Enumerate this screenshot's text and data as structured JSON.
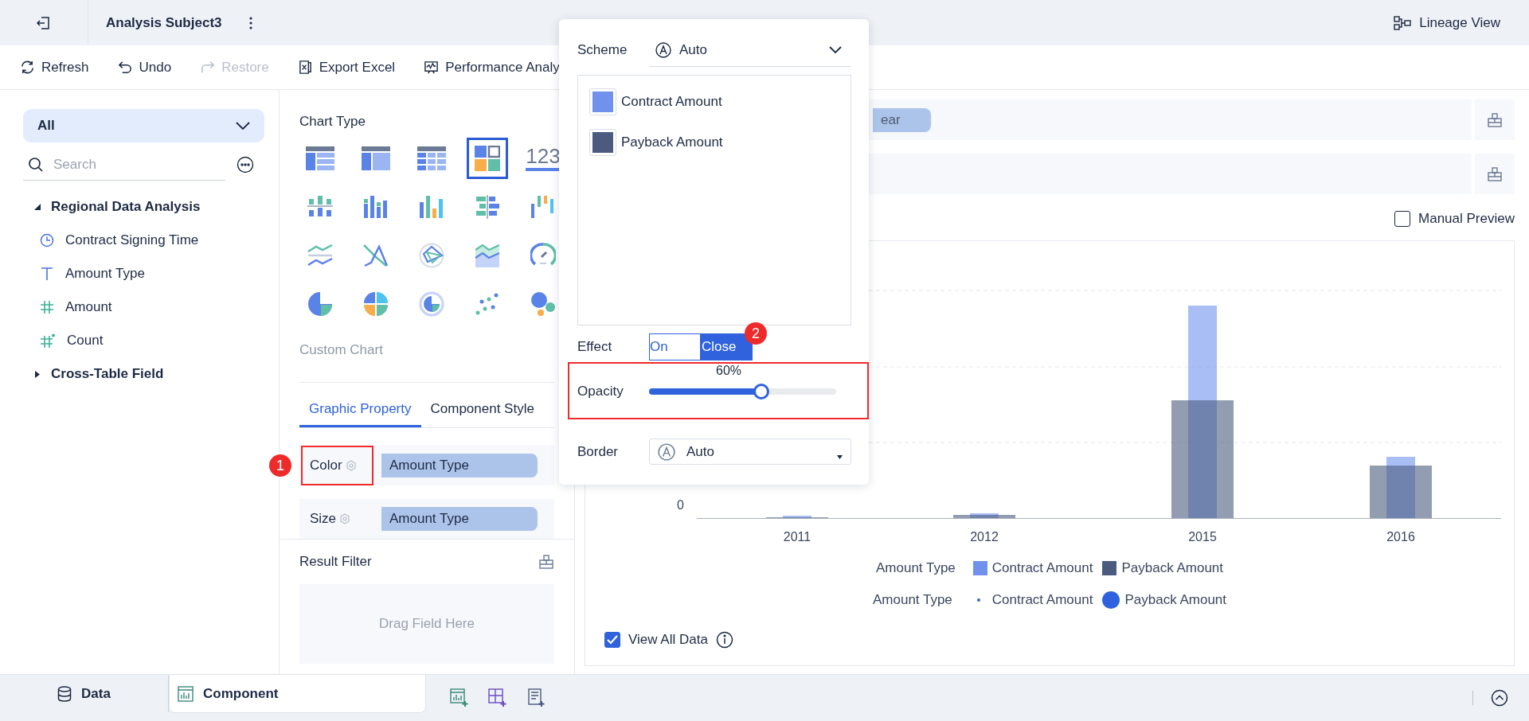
{
  "header": {
    "title": "Analysis Subject3",
    "lineage_button": "Lineage View"
  },
  "toolbar": [
    {
      "label": "Refresh",
      "disabled": false
    },
    {
      "label": "Undo",
      "disabled": false
    },
    {
      "label": "Restore",
      "disabled": true
    },
    {
      "label": "Export Excel",
      "disabled": false
    },
    {
      "label": "Performance Analy",
      "disabled": false
    }
  ],
  "fields_panel": {
    "scope": "All",
    "search_placeholder": "Search",
    "tree": [
      {
        "label": "Regional Data Analysis",
        "expanded": true,
        "children": [
          {
            "label": "Contract Signing Time",
            "kind": "date"
          },
          {
            "label": "Amount Type",
            "kind": "text"
          },
          {
            "label": "Amount",
            "kind": "number"
          },
          {
            "label": "Count",
            "kind": "count"
          }
        ]
      },
      {
        "label": "Cross-Table Field",
        "expanded": false
      }
    ]
  },
  "chart_type_panel": {
    "heading": "Chart Type",
    "types": [
      {
        "selected": false
      },
      {
        "selected": false
      },
      {
        "selected": false
      },
      {
        "selected": true
      },
      {
        "selected": false,
        "label": "123"
      },
      {
        "selected": false
      },
      {
        "selected": false
      },
      {
        "selected": false
      },
      {
        "selected": false
      },
      {
        "selected": false
      },
      {
        "selected": false
      },
      {
        "selected": false
      },
      {
        "selected": false
      },
      {
        "selected": false
      },
      {
        "selected": false
      },
      {
        "selected": false
      },
      {
        "selected": false
      },
      {
        "selected": false
      },
      {
        "selected": false
      },
      {
        "selected": false
      }
    ],
    "custom_heading": "Custom Chart"
  },
  "property_tabs": [
    {
      "label": "Graphic Property",
      "selected": true
    },
    {
      "label": "Component Style",
      "selected": false
    }
  ],
  "properties": [
    {
      "label": "Color",
      "field": "Amount Type",
      "highlighted": true,
      "callout": "1"
    },
    {
      "label": "Size",
      "field": "Amount Type",
      "highlighted": false
    }
  ],
  "result_filter": {
    "title": "Result Filter",
    "placeholder": "Drag Field Here"
  },
  "popup": {
    "scheme_label": "Scheme",
    "scheme": "Auto",
    "colors": [
      {
        "label": "Contract Amount",
        "color": "#7092ec"
      },
      {
        "label": "Payback Amount",
        "color": "#4b5b7f"
      }
    ],
    "effect_label": "Effect",
    "effect_options": [
      {
        "label": "On",
        "selected": false
      },
      {
        "label": "Close",
        "selected": true
      }
    ],
    "effect_callout": "2",
    "opacity_label": "Opacity",
    "opacity_reading": "60%",
    "opacity": {
      "level": 0.6
    },
    "opacity_highlighted": true,
    "border_label": "Border",
    "border": "Auto"
  },
  "filter_pill": "ear",
  "manual_preview": {
    "label": "Manual Preview",
    "checked": false
  },
  "chart": {
    "y_tick": "0",
    "categories": [
      "2011",
      "2012",
      "2015",
      "2016"
    ],
    "legends": [
      {
        "title": "Amount Type",
        "kind": "color",
        "items": [
          {
            "label": "Contract Amount",
            "color": "#7092ec"
          },
          {
            "label": "Payback Amount",
            "color": "#4b5b7f"
          }
        ]
      },
      {
        "title": "Amount Type",
        "kind": "size",
        "items": [
          {
            "label": "Contract Amount"
          },
          {
            "label": "Payback Amount"
          }
        ]
      }
    ]
  },
  "view_all": {
    "label": "View All Data",
    "checked": true
  },
  "bottom_tabs": [
    {
      "label": "Data",
      "selected": false
    },
    {
      "label": "Component",
      "selected": true
    }
  ]
}
